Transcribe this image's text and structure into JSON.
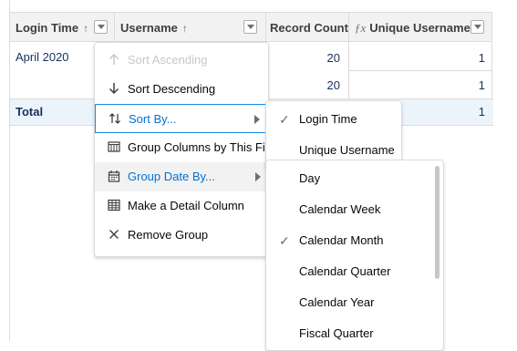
{
  "table": {
    "columns": [
      {
        "label": "Login Time",
        "sort_arrow": "↑"
      },
      {
        "label": "Username",
        "sort_arrow": "↑"
      },
      {
        "label": "Record Count"
      },
      {
        "label": "Unique Username",
        "formula_icon": "ƒx"
      }
    ],
    "rows": [
      {
        "login_time": "April 2020",
        "record_count": "20",
        "unique_username": "1"
      },
      {
        "login_time": "",
        "record_count": "20",
        "unique_username": "1"
      }
    ],
    "total": {
      "label": "Total",
      "unique_username": "1"
    }
  },
  "column_menu": {
    "items": [
      {
        "label": "Sort Ascending",
        "icon": "arrow-up-icon",
        "state": "disabled"
      },
      {
        "label": "Sort Descending",
        "icon": "arrow-down-icon"
      },
      {
        "label": "Sort By...",
        "icon": "sort-icon",
        "state": "focused",
        "submenu": true
      },
      {
        "label": "Group Columns by This Field",
        "icon": "column-grid-icon"
      },
      {
        "label": "Group Date By...",
        "icon": "calendar-icon",
        "state": "active",
        "submenu": true
      },
      {
        "label": "Make a Detail Column",
        "icon": "table-icon"
      },
      {
        "label": "Remove Group",
        "icon": "close-icon"
      }
    ]
  },
  "sort_by_menu": {
    "items": [
      {
        "label": "Login Time",
        "checked": true
      },
      {
        "label": "Unique Username",
        "checked": false
      }
    ]
  },
  "group_date_menu": {
    "items": [
      {
        "label": "Day",
        "checked": false
      },
      {
        "label": "Calendar Week",
        "checked": false
      },
      {
        "label": "Calendar Month",
        "checked": true
      },
      {
        "label": "Calendar Quarter",
        "checked": false
      },
      {
        "label": "Calendar Year",
        "checked": false
      },
      {
        "label": "Fiscal Quarter",
        "checked": false
      }
    ]
  },
  "colors": {
    "accent": "#0070d2",
    "header_bg": "#f3f2f2",
    "total_bg": "#ecf4fb",
    "border": "#dddbda"
  }
}
